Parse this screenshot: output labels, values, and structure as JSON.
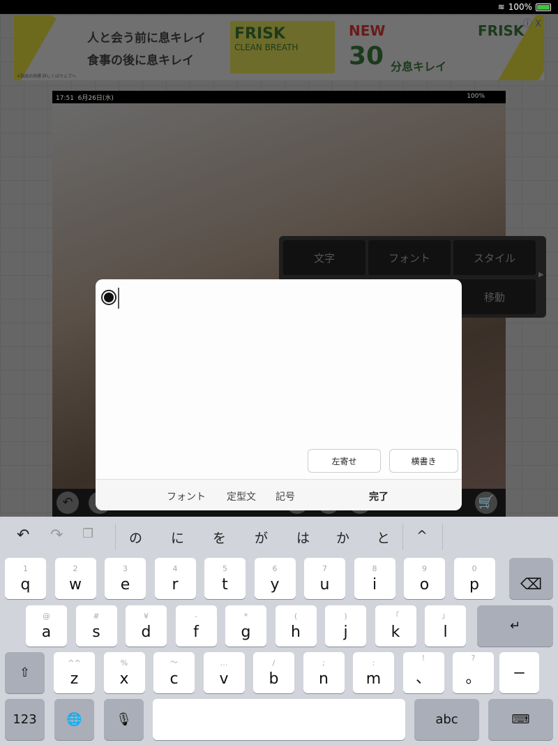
{
  "status_bar": {
    "wifi_icon": "wifi-icon",
    "battery_percent": "100%",
    "battery_level": 1.0,
    "charging": true
  },
  "ad": {
    "line1": "人と会う前に息キレイ",
    "line2": "食事の後に息キレイ",
    "product": "FRISK",
    "product_sub": "CLEAN BREATH",
    "new_label": "NEW",
    "big_number": "30",
    "tagline": "分息キレイ",
    "brand": "FRISK",
    "close": "ⓘ X",
    "note": "※製品の商標 詳しくはウェブへ"
  },
  "inner_status": {
    "time": "17:51",
    "date": "6月26日(水)",
    "battery": "100%"
  },
  "menu": {
    "items": [
      "文字",
      "フォント",
      "スタイル",
      "移動"
    ]
  },
  "dialog": {
    "align_button": "左寄せ",
    "direction_button": "横書き",
    "footer": {
      "font": "フォント",
      "template": "定型文",
      "symbol": "記号",
      "done": "完了"
    }
  },
  "keyboard": {
    "suggestions": [
      "の",
      "に",
      "を",
      "が",
      "は",
      "か",
      "と"
    ],
    "expand": "^",
    "row1": [
      [
        "1",
        "q"
      ],
      [
        "2",
        "w"
      ],
      [
        "3",
        "e"
      ],
      [
        "4",
        "r"
      ],
      [
        "5",
        "t"
      ],
      [
        "6",
        "y"
      ],
      [
        "7",
        "u"
      ],
      [
        "8",
        "i"
      ],
      [
        "9",
        "o"
      ],
      [
        "0",
        "p"
      ]
    ],
    "row2": [
      [
        "@",
        "a"
      ],
      [
        "#",
        "s"
      ],
      [
        "¥",
        "d"
      ],
      [
        "-",
        "f"
      ],
      [
        "*",
        "g"
      ],
      [
        "(",
        "h"
      ],
      [
        ")",
        "j"
      ],
      [
        "「",
        "k"
      ],
      [
        "」",
        "l"
      ]
    ],
    "row3": [
      [
        "^^",
        "z"
      ],
      [
        "%",
        "x"
      ],
      [
        "〜",
        "c"
      ],
      [
        "…",
        "v"
      ],
      [
        "/",
        "b"
      ],
      [
        ";",
        "n"
      ],
      [
        ":",
        "m"
      ],
      [
        "!",
        "、"
      ],
      [
        "?",
        "。"
      ]
    ],
    "dash": "ー",
    "numbers": "123",
    "abc": "abc"
  }
}
